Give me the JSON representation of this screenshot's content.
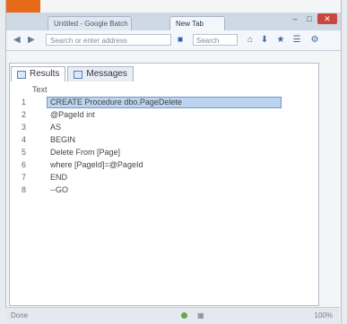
{
  "browser": {
    "tabs": [
      {
        "label": "Untitled - Google Batch"
      },
      {
        "label": "New Tab"
      }
    ],
    "window_controls": {
      "minimize": "–",
      "maximize": "□",
      "close": "✕"
    },
    "url_placeholder": "Search or enter address",
    "search_placeholder": "Search",
    "colors": {
      "title_accent": "#e66a1a",
      "close_button": "#c9473c"
    }
  },
  "results_panel": {
    "tabs": [
      {
        "label": "Results"
      },
      {
        "label": "Messages"
      }
    ],
    "column_header": "Text",
    "rows": [
      {
        "num": "1",
        "text": "CREATE Procedure dbo.PageDelete"
      },
      {
        "num": "2",
        "text": "@PageId int"
      },
      {
        "num": "3",
        "text": "AS"
      },
      {
        "num": "4",
        "text": "BEGIN"
      },
      {
        "num": "5",
        "text": "Delete From [Page]"
      },
      {
        "num": "6",
        "text": "where [PageId]=@PageId"
      },
      {
        "num": "7",
        "text": "END"
      },
      {
        "num": "8",
        "text": "--GO"
      }
    ],
    "selected_row": 1
  },
  "status": {
    "left": "Done",
    "right": "100%"
  }
}
